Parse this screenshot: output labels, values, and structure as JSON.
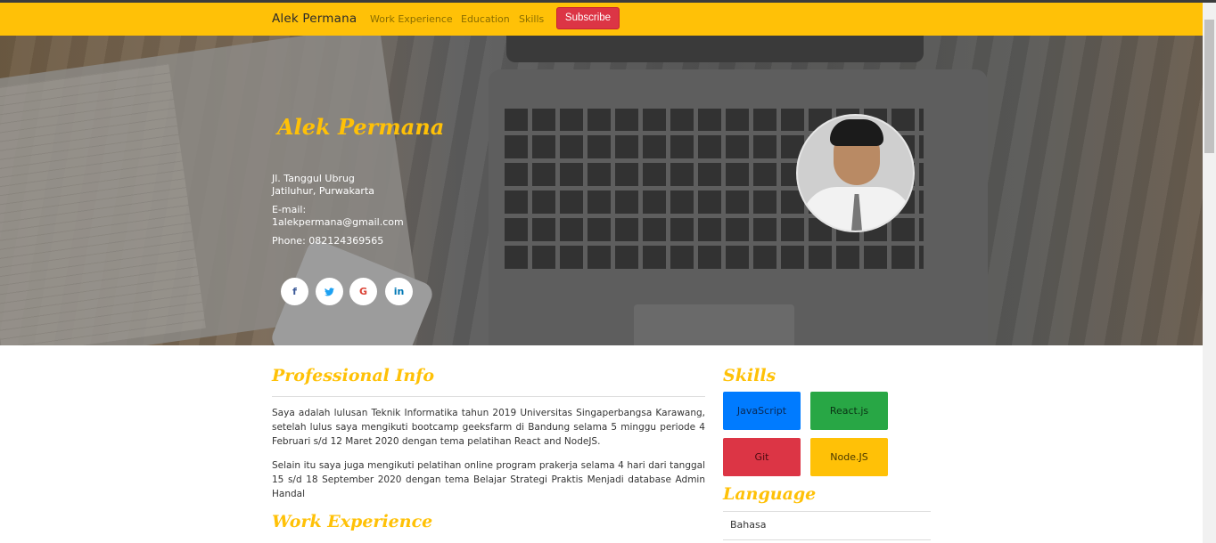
{
  "navbar": {
    "brand": "Alek Permana",
    "links": [
      "Work Experience",
      "Education",
      "Skills"
    ],
    "subscribe_label": "Subscribe"
  },
  "hero": {
    "name": "Alek Permana",
    "address_line1": "Jl. Tanggul Ubrug",
    "address_line2": "Jatiluhur, Purwakarta",
    "email_label": "E-mail:",
    "email": "1alekpermana@gmail.com",
    "phone": "Phone: 082124369565",
    "social": [
      {
        "icon": "facebook-icon",
        "glyph": "f",
        "color": "#3b5998"
      },
      {
        "icon": "twitter-icon",
        "glyph": "❘",
        "color": "#1da1f2"
      },
      {
        "icon": "google-icon",
        "glyph": "G",
        "color": "#db4437"
      },
      {
        "icon": "linkedin-icon",
        "glyph": "in",
        "color": "#0077b5"
      }
    ]
  },
  "professional_info": {
    "title": "Professional Info",
    "para1": "Saya adalah lulusan Teknik Informatika tahun 2019 Universitas Singaperbangsa Karawang, setelah lulus saya mengikuti bootcamp geeksfarm di Bandung selama 5 minggu periode 4 Februari s/d 12 Maret 2020 dengan tema pelatihan React and NodeJS.",
    "para2": "Selain itu saya juga mengikuti pelatihan online program prakerja selama 4 hari dari tanggal 15 s/d 18 September 2020 dengan tema Belajar Strategi Praktis Menjadi database Admin Handal"
  },
  "work_experience": {
    "title": "Work Experience"
  },
  "skills": {
    "title": "Skills",
    "items": [
      {
        "label": "JavaScript",
        "bg": "#007bff"
      },
      {
        "label": "React.js",
        "bg": "#28a745"
      },
      {
        "label": "Git",
        "bg": "#dc3545"
      },
      {
        "label": "Node.JS",
        "bg": "#ffc107"
      }
    ]
  },
  "language": {
    "title": "Language",
    "items": [
      "Bahasa"
    ]
  },
  "colors": {
    "accent": "#ffc107",
    "danger": "#dc3545"
  }
}
